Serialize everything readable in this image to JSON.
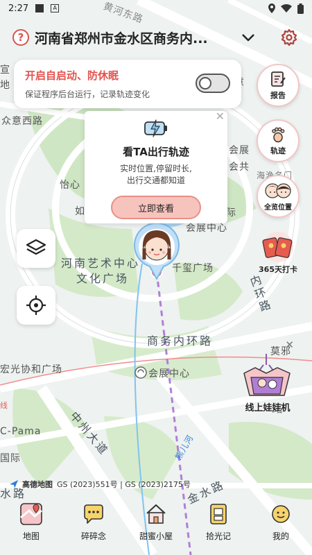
{
  "status_bar": {
    "time": "2:27"
  },
  "header": {
    "help_icon": "question-circle-icon",
    "location": "河南省郑州市金水区商务内...",
    "dropdown_icon": "triangle-down-icon",
    "settings_icon": "gear-icon"
  },
  "autostart": {
    "title": "开启自启动、防休眠",
    "desc": "保证程序后台运行，记录轨迹变化",
    "toggle_on": false
  },
  "side_buttons": [
    {
      "label": "报告",
      "icon": "report-icon"
    },
    {
      "label": "轨迹",
      "icon": "footprint-icon"
    },
    {
      "label": "全览位置",
      "icon": "couple-avatar-icon"
    },
    {
      "label": "365天打卡",
      "icon": "red-envelope-icon"
    }
  ],
  "promo": {
    "title": "看TA出行轨迹",
    "desc1": "实时位置,停留时长,",
    "desc2": "出行交通都知道",
    "button": "立即查看"
  },
  "claw_machine": {
    "label": "线上娃娃机"
  },
  "map_labels": {
    "l1": "黄河东路",
    "l2": "众意西路",
    "l3": "河南艺术中心",
    "l4": "文化广场",
    "l5": "千玺广场",
    "l6": "商务内环路",
    "l7": "会展中心",
    "l8": "中州大道",
    "l9": "宏光协和广场",
    "l10": "金水路",
    "l11": "会展中心",
    "l12": "海渔名门",
    "l13": "莫邪",
    "l14": "C-Pama",
    "l15": "国际",
    "l16": "水路",
    "l17": "商务外环路",
    "l18": "熊儿河",
    "l19": "怡心",
    "l20": "如",
    "l21": "内环路",
    "l22": "宣",
    "l23": "地",
    "l24": "会展",
    "l25": "会共",
    "l26": "际",
    "l27": "线",
    "l28": "会",
    "l29": "路",
    "l30": "意"
  },
  "copyright": {
    "logo": "高德地图",
    "text": "GS (2023)551号 | GS (2023)2175号"
  },
  "bottom_nav": [
    {
      "label": "地图",
      "icon": "map-icon"
    },
    {
      "label": "碎碎念",
      "icon": "chat-bubble-icon"
    },
    {
      "label": "甜蜜小屋",
      "icon": "house-icon"
    },
    {
      "label": "拾光记",
      "icon": "film-icon"
    },
    {
      "label": "我的",
      "icon": "smiley-icon"
    }
  ],
  "colors": {
    "accent_red": "#e4524d",
    "promo_button": "#f7c3bd",
    "route_purple": "#b07fd8",
    "map_green": "#cfe7c5",
    "map_road": "#ffffff"
  }
}
